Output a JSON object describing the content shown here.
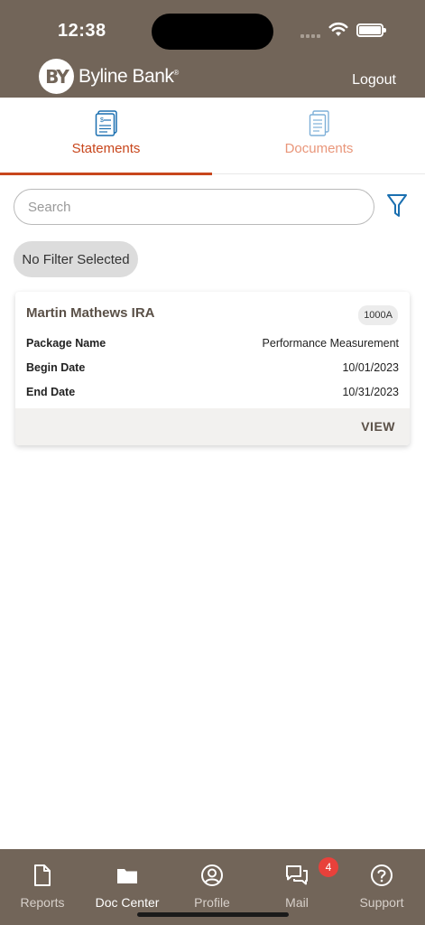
{
  "status_bar": {
    "time": "12:38"
  },
  "header": {
    "brand": "Byline Bank",
    "brand_mark": "BY",
    "logout_label": "Logout"
  },
  "tabs": [
    {
      "label": "Statements",
      "active": true
    },
    {
      "label": "Documents",
      "active": false
    }
  ],
  "search": {
    "placeholder": "Search"
  },
  "filter_chip": {
    "label": "No Filter Selected"
  },
  "card": {
    "title": "Martin Mathews IRA",
    "account_badge": "1000A",
    "rows": [
      {
        "label": "Package Name",
        "value": "Performance Measurement"
      },
      {
        "label": "Begin Date",
        "value": "10/01/2023"
      },
      {
        "label": "End Date",
        "value": "10/31/2023"
      }
    ],
    "action_label": "VIEW"
  },
  "bottom_nav": {
    "items": [
      {
        "label": "Reports",
        "icon": "document-icon"
      },
      {
        "label": "Doc Center",
        "icon": "folder-icon",
        "active": true
      },
      {
        "label": "Profile",
        "icon": "user-circle-icon"
      },
      {
        "label": "Mail",
        "icon": "chat-icon",
        "badge": "4"
      },
      {
        "label": "Support",
        "icon": "help-circle-icon"
      }
    ]
  },
  "colors": {
    "header_bg": "#726559",
    "accent": "#c8461c",
    "accent_light": "#e9967a",
    "filter_blue": "#1a6fb0",
    "badge_red": "#e8413b"
  }
}
